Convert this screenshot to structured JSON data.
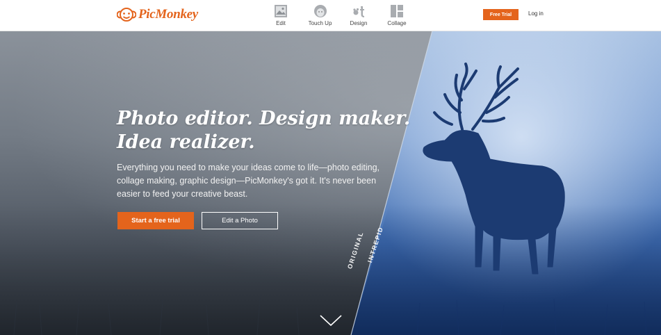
{
  "header": {
    "logo_text": "PicMonkey",
    "nav": [
      {
        "label": "Edit",
        "icon": "image-icon"
      },
      {
        "label": "Touch Up",
        "icon": "face-icon"
      },
      {
        "label": "Design",
        "icon": "design-icon"
      },
      {
        "label": "Collage",
        "icon": "collage-icon"
      }
    ],
    "free_trial_label": "Free Trial",
    "login_label": "Log in"
  },
  "hero": {
    "headline_line1": "Photo editor. Design maker.",
    "headline_line2": "Idea realizer.",
    "subtext": "Everything you need to make your ideas come to life—photo editing, collage making, graphic design—PicMonkey's got it. It's never been easier to feed your creative beast.",
    "primary_button": "Start a free trial",
    "secondary_button": "Edit a Photo",
    "label_original": "ORIGINAL",
    "label_intrepid": "INTREPID"
  },
  "colors": {
    "accent": "#e4641c",
    "header_bg": "#ffffff",
    "hero_gray": "#5b6572",
    "hero_blue": "#3f70b4"
  }
}
